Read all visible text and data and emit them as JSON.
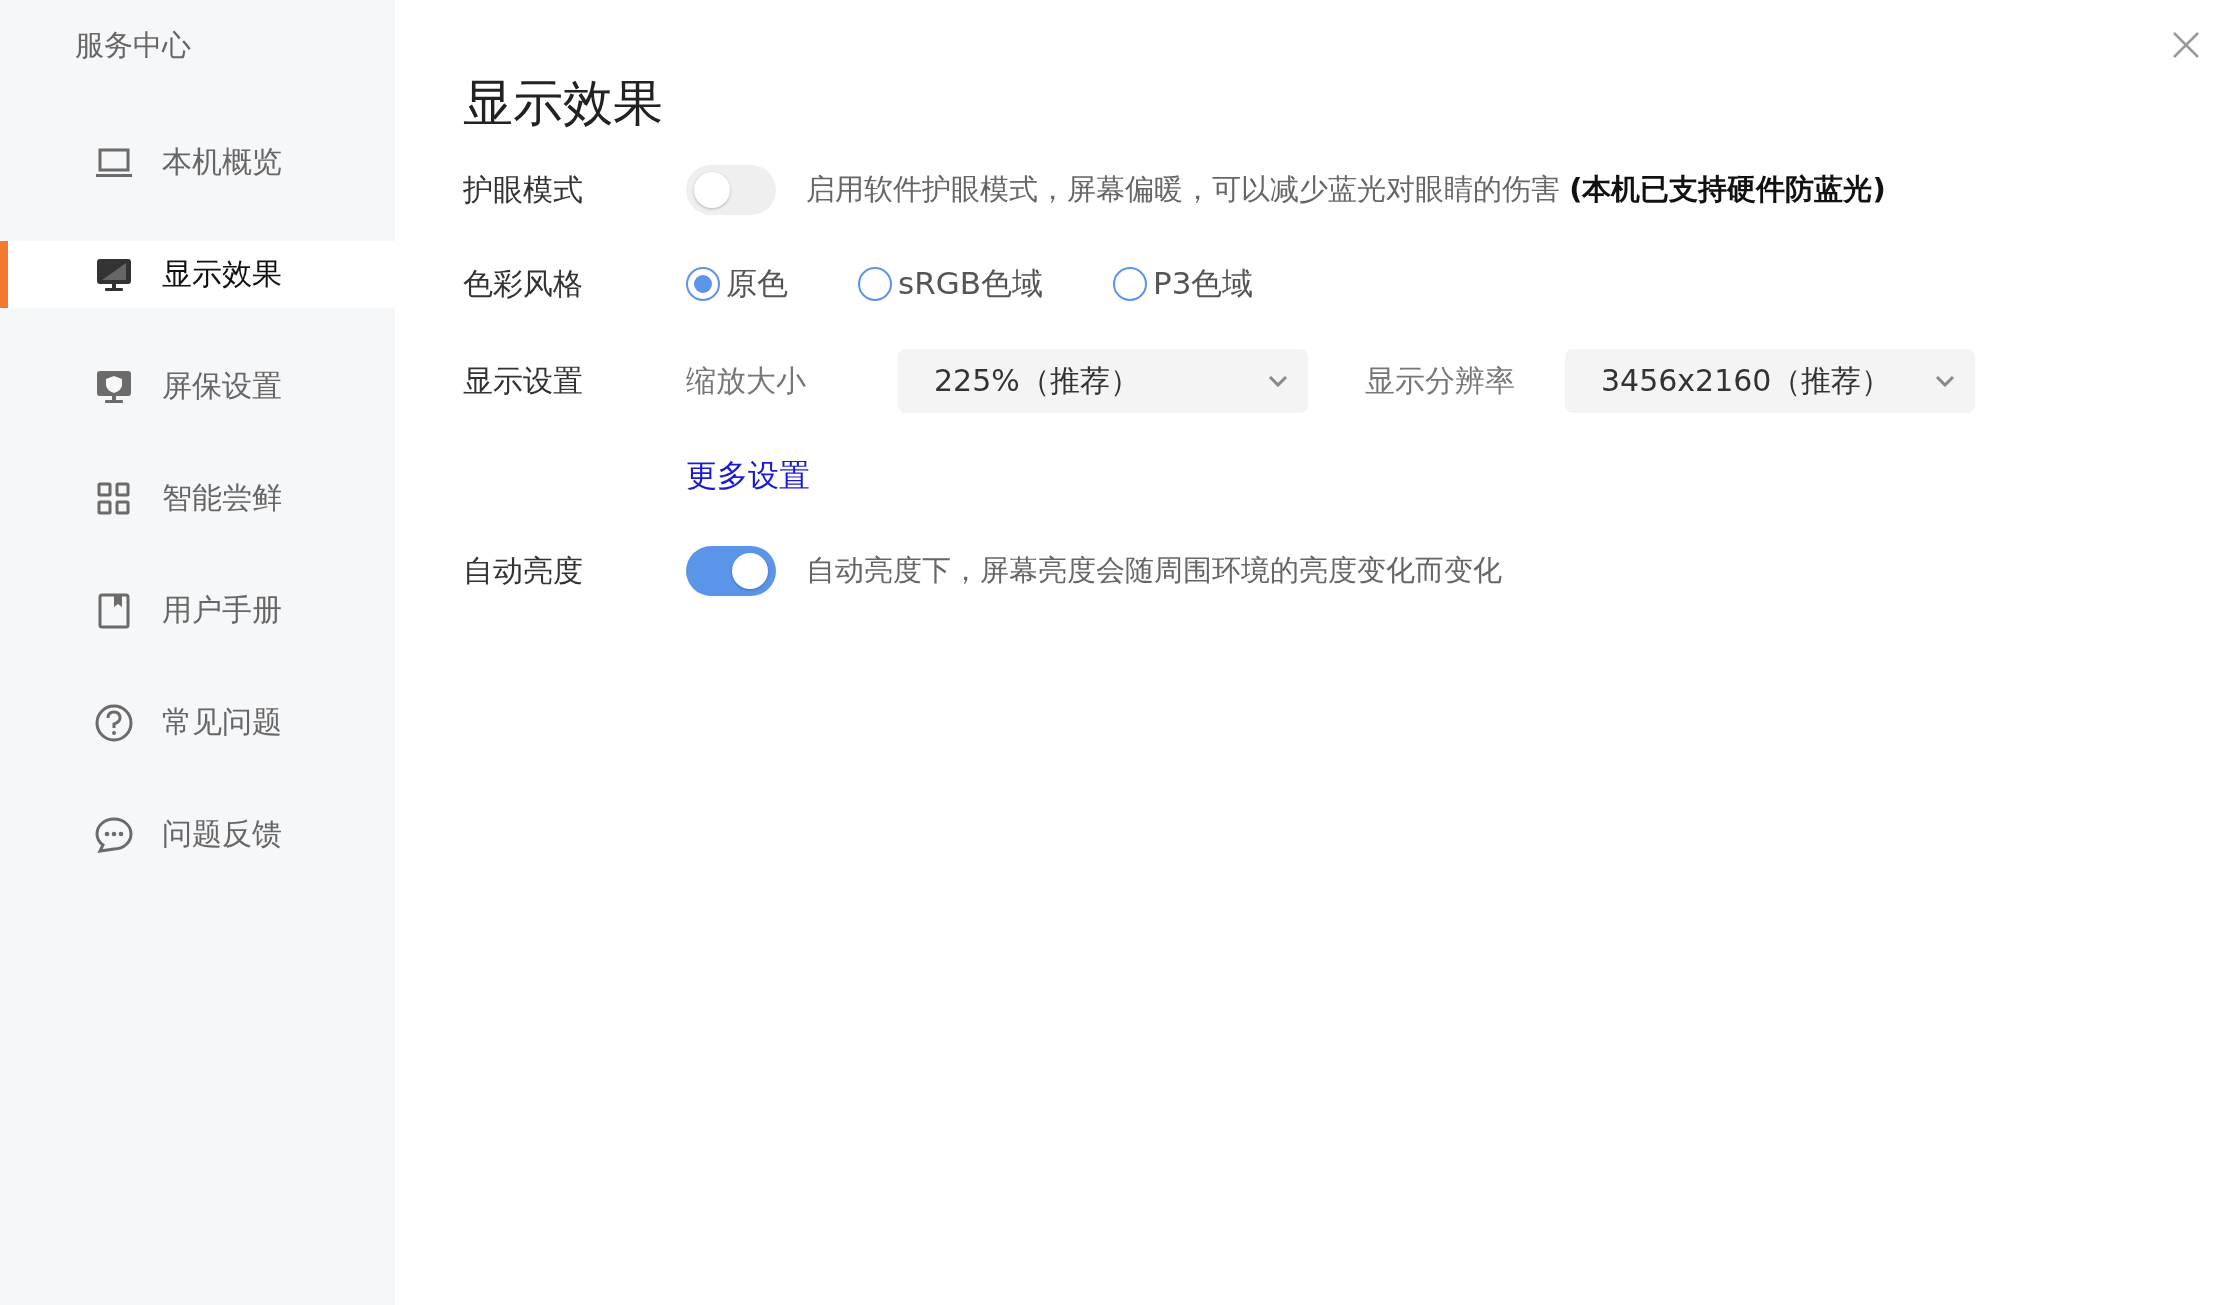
{
  "sidebar": {
    "title": "服务中心",
    "items": [
      {
        "label": "本机概览",
        "selected": false
      },
      {
        "label": "显示效果",
        "selected": true
      },
      {
        "label": "屏保设置",
        "selected": false
      },
      {
        "label": "智能尝鲜",
        "selected": false
      },
      {
        "label": "用户手册",
        "selected": false
      },
      {
        "label": "常见问题",
        "selected": false
      },
      {
        "label": "问题反馈",
        "selected": false
      }
    ]
  },
  "page": {
    "title": "显示效果",
    "eye_care": {
      "label": "护眼模式",
      "on": false,
      "description": "启用软件护眼模式，屏幕偏暖，可以减少蓝光对眼睛的伤害 **(本机已支持硬件防蓝光)**"
    },
    "color_style": {
      "label": "色彩风格",
      "options": [
        {
          "label": "原色",
          "selected": true
        },
        {
          "label": "sRGB色域",
          "selected": false
        },
        {
          "label": "P3色域",
          "selected": false
        }
      ]
    },
    "display_settings": {
      "label": "显示设置",
      "scale_label": "缩放大小",
      "scale_value": "225%（推荐）",
      "resolution_label": "显示分辨率",
      "resolution_value": "3456x2160（推荐）",
      "more_link": "更多设置"
    },
    "auto_brightness": {
      "label": "自动亮度",
      "on": true,
      "description": "自动亮度下，屏幕亮度会随周围环境的亮度变化而变化"
    }
  }
}
